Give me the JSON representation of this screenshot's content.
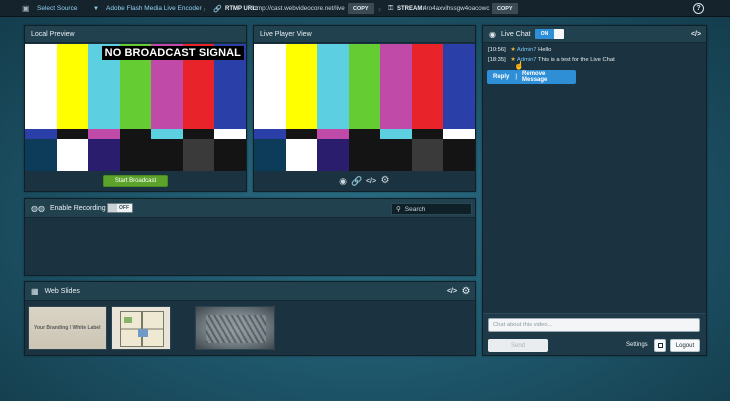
{
  "topbar": {
    "source_label": "Select Source",
    "encoder_label": "Adobe Flash Media Live Encoder",
    "rtmp_label": "RTMP URL:",
    "rtmp_value": "rtmp://cast.webvideocore.net/live",
    "copy_label": "COPY",
    "stream_label": "STREAM:",
    "stream_value": "4ro4axvihssgw4oacowc"
  },
  "local_preview": {
    "title": "Local Preview",
    "overlay": "NO BROADCAST SIGNAL",
    "start_button": "Start Broadcast"
  },
  "live_player": {
    "title": "Live Player View"
  },
  "recording": {
    "title": "Enable Recording",
    "toggle_label": "OFF",
    "search_placeholder": "Search"
  },
  "web_slides": {
    "title": "Web Slides",
    "slide1_text": "Your Branding / White Label"
  },
  "live_chat": {
    "title": "Live Chat",
    "toggle_label": "ON",
    "messages": [
      {
        "time": "[10:56]",
        "user": "Admin7",
        "text": "Hello"
      },
      {
        "time": "[18:35]",
        "user": "Admin7",
        "text": "This is a test for the Live Chat"
      }
    ],
    "reply_label": "Reply",
    "remove_label": "Remove Message",
    "input_placeholder": "Chat about this video...",
    "send_label": "Send",
    "settings_label": "Settings",
    "logout_label": "Logout"
  },
  "colors": {
    "accent": "#2f8fd6",
    "green": "#5ca32c",
    "bars_top": [
      "#ffffff",
      "#ffff00",
      "#5ccfe0",
      "#66cc33",
      "#c04aa8",
      "#e8232a",
      "#2a3fa8"
    ],
    "bars_mid": [
      "#2a3fa8",
      "#141414",
      "#c04aa8",
      "#141414",
      "#5ccfe0",
      "#141414",
      "#ffffff"
    ],
    "bars_bot": [
      "#0d3b5a",
      "#ffffff",
      "#2a1d6e",
      "#141414",
      "#141414",
      "#3a3a3a",
      "#141414"
    ]
  }
}
